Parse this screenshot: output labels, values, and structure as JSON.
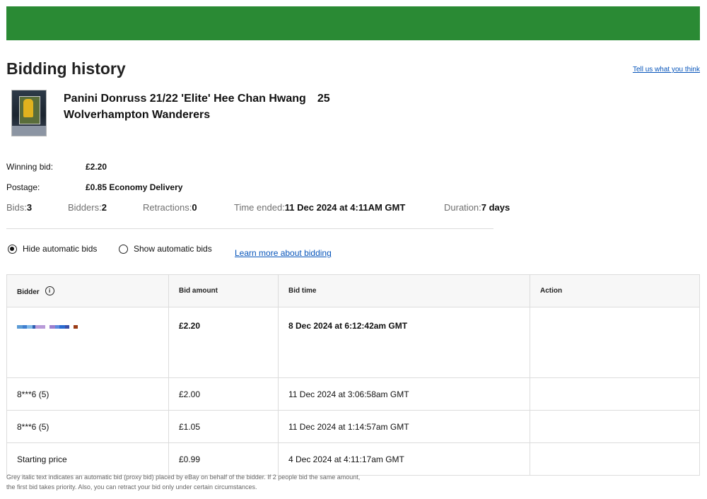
{
  "header": {
    "title": "Bidding history",
    "feedback_link": "Tell us what you think"
  },
  "item": {
    "title": "Panini Donruss 21/22 'Elite' Hee Chan Hwang",
    "number": "25",
    "subtitle": "Wolverhampton Wanderers"
  },
  "summary": {
    "winning_bid_label": "Winning bid:",
    "winning_bid_value": "£2.20",
    "postage_label": "Postage:",
    "postage_value": "£0.85 Economy Delivery"
  },
  "stats": {
    "bids_label": "Bids:",
    "bids_value": "3",
    "bidders_label": "Bidders:",
    "bidders_value": "2",
    "retractions_label": "Retractions:",
    "retractions_value": "0",
    "time_ended_label": "Time ended:",
    "time_ended_value": "11 Dec 2024 at 4:11AM GMT",
    "duration_label": "Duration:",
    "duration_value": "7 days"
  },
  "options": {
    "hide_auto": "Hide automatic bids",
    "show_auto": "Show automatic bids",
    "selected": "hide",
    "learn_more": "Learn more about bidding"
  },
  "table": {
    "headers": {
      "bidder": "Bidder",
      "bid_amount": "Bid amount",
      "bid_time": "Bid time",
      "action": "Action"
    },
    "rows": [
      {
        "bidder": "",
        "amount": "£2.20",
        "time": "8 Dec 2024 at 6:12:42am GMT",
        "action": ""
      },
      {
        "bidder": "8***6 (5)",
        "amount": "£2.00",
        "time": "11 Dec 2024 at 3:06:58am GMT",
        "action": ""
      },
      {
        "bidder": "8***6 (5)",
        "amount": "£1.05",
        "time": "11 Dec 2024 at 1:14:57am GMT",
        "action": ""
      },
      {
        "bidder": "Starting price",
        "amount": "£0.99",
        "time": "4 Dec 2024 at 4:11:17am GMT",
        "action": ""
      }
    ]
  },
  "footnote": {
    "line1": "Grey italic text indicates an automatic bid (proxy bid) placed by eBay on behalf of the bidder. If 2 people bid the same amount,",
    "line2": "the first bid takes priority. Also, you can retract your bid only under certain circumstances."
  },
  "colors": {
    "header_bar": "#2a8a34",
    "link": "#0654ba",
    "muted_text": "#707070"
  }
}
